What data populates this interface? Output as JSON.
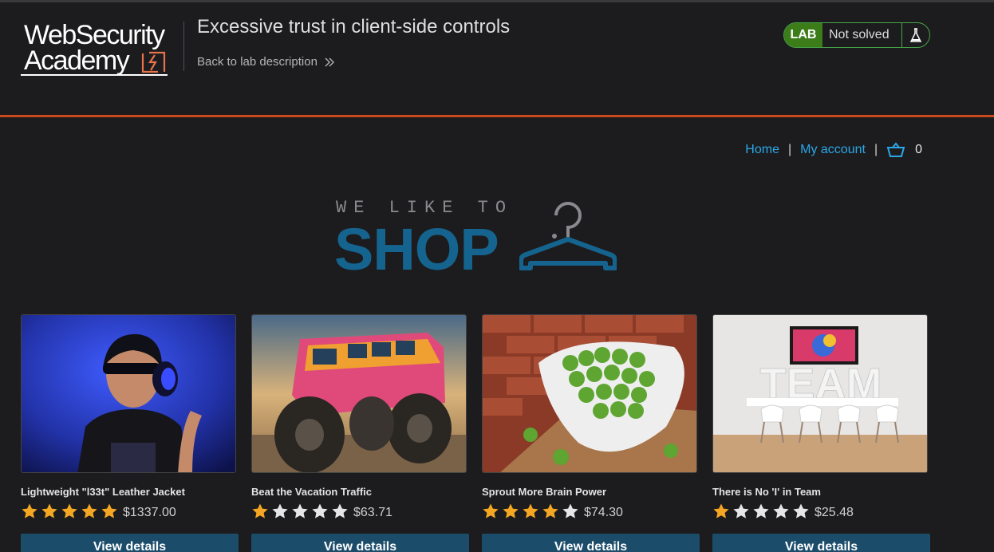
{
  "header": {
    "logo_line1": "WebSecurity",
    "logo_line2": "Academy",
    "lab_title": "Excessive trust in client-side controls",
    "back_link": "Back to lab description",
    "status_badge": "LAB",
    "status_text": "Not solved"
  },
  "nav": {
    "home": "Home",
    "separator": "|",
    "my_account": "My account",
    "cart_count": "0"
  },
  "hero": {
    "small_text": "WE LIKE TO",
    "big_text": "SHOP"
  },
  "products": [
    {
      "name": "Lightweight \"l33t\" Leather Jacket",
      "rating": 5,
      "price": "$1337.00",
      "button": "View details"
    },
    {
      "name": "Beat the Vacation Traffic",
      "rating": 1,
      "price": "$63.71",
      "button": "View details"
    },
    {
      "name": "Sprout More Brain Power",
      "rating": 4,
      "price": "$74.30",
      "button": "View details"
    },
    {
      "name": "There is No 'I' in Team",
      "rating": 1,
      "price": "$25.48",
      "button": "View details"
    }
  ],
  "colors": {
    "accent_orange": "#c74a1c",
    "link_blue": "#2aa7e8",
    "button_blue": "#1b4d6b",
    "lab_green": "#3c7d1a",
    "star_gold": "#f5a623"
  }
}
